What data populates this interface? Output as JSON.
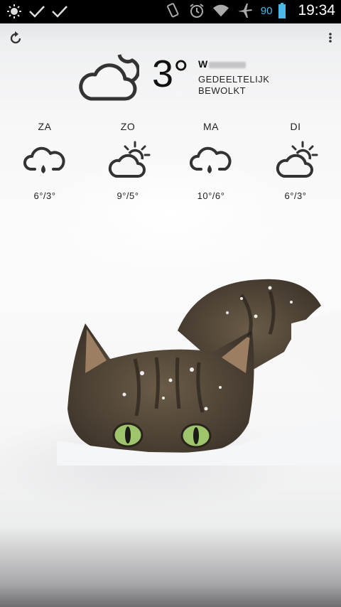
{
  "statusbar": {
    "battery_level": "90",
    "time": "19:34",
    "icons_left": [
      "brightness-icon",
      "check-icon",
      "check-icon"
    ],
    "icons_right": [
      "vibrate-icon",
      "alarm-icon",
      "wifi-icon",
      "airplane-icon",
      "battery-icon"
    ]
  },
  "toolbar": {
    "refresh_icon": "refresh-icon",
    "menu_icon": "overflow-menu-icon"
  },
  "current": {
    "icon": "partly-cloudy-night-icon",
    "temperature": "3°",
    "city": "W",
    "condition_line1": "GEDEELTELIJK",
    "condition_line2": "BEWOLKT"
  },
  "forecast": [
    {
      "day": "ZA",
      "icon": "rain-cloud-icon",
      "temps": "6°/3°"
    },
    {
      "day": "ZO",
      "icon": "partly-sunny-icon",
      "temps": "9°/5°"
    },
    {
      "day": "MA",
      "icon": "rain-cloud-icon",
      "temps": "10°/6°"
    },
    {
      "day": "DI",
      "icon": "partly-sunny-icon",
      "temps": "6°/3°"
    }
  ],
  "wallpaper": "cat-in-snow"
}
